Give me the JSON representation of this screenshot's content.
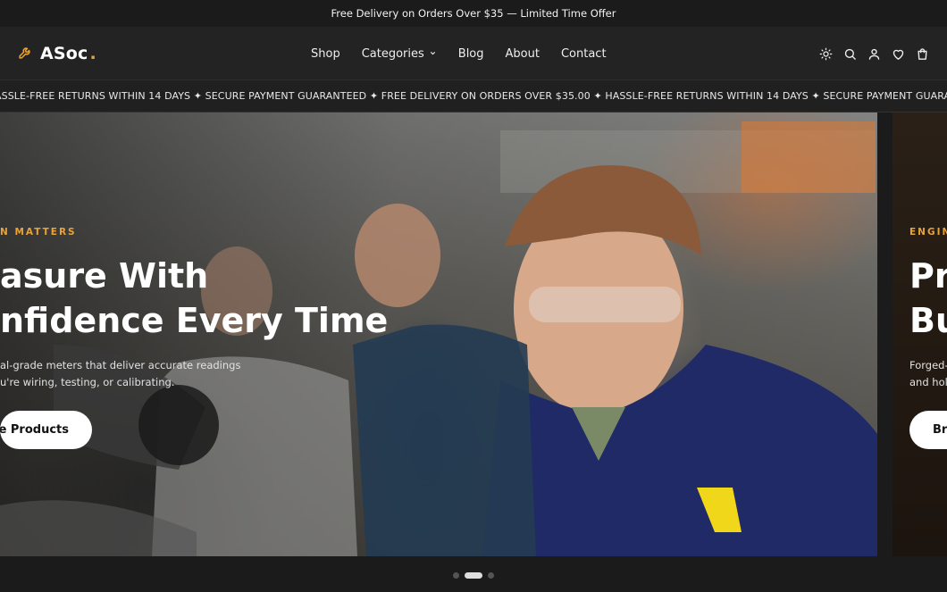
{
  "announcement": "Free Delivery on Orders Over $35 — Limited Time Offer",
  "brand": {
    "name": "ASoc",
    "dot": ".",
    "accent": "#e8a23a"
  },
  "nav": [
    {
      "label": "Shop"
    },
    {
      "label": "Categories"
    },
    {
      "label": "Blog"
    },
    {
      "label": "About"
    },
    {
      "label": "Contact"
    }
  ],
  "ticker": "ASSLE-FREE RETURNS WITHIN 14 DAYS ✦ SECURE PAYMENT GUARANTEED ✦ FREE DELIVERY ON ORDERS OVER $35.00 ✦ HASSLE-FREE RETURNS WITHIN 14 DAYS ✦ SECURE PAYMENT GUARANTEED ✦",
  "slides": {
    "main": {
      "eyebrow": "N MATTERS",
      "headline_line1": "asure With",
      "headline_line2": "nfidence Every Time",
      "desc_line1": "al-grade meters that deliver accurate readings",
      "desc_line2": "u're wiring, testing, or calibrating.",
      "cta": "se Products"
    },
    "next": {
      "eyebrow": "ENGIN",
      "headline_line1": "Pr",
      "headline_line2": "Bu",
      "desc_line1": "Forged-",
      "desc_line2": "and hol",
      "cta": "Br"
    }
  },
  "icons": [
    "sun-icon",
    "search-icon",
    "user-icon",
    "heart-icon",
    "cart-icon",
    "wrench-icon",
    "chevron-down-icon"
  ],
  "carousel": {
    "count": 3,
    "active": 2
  }
}
